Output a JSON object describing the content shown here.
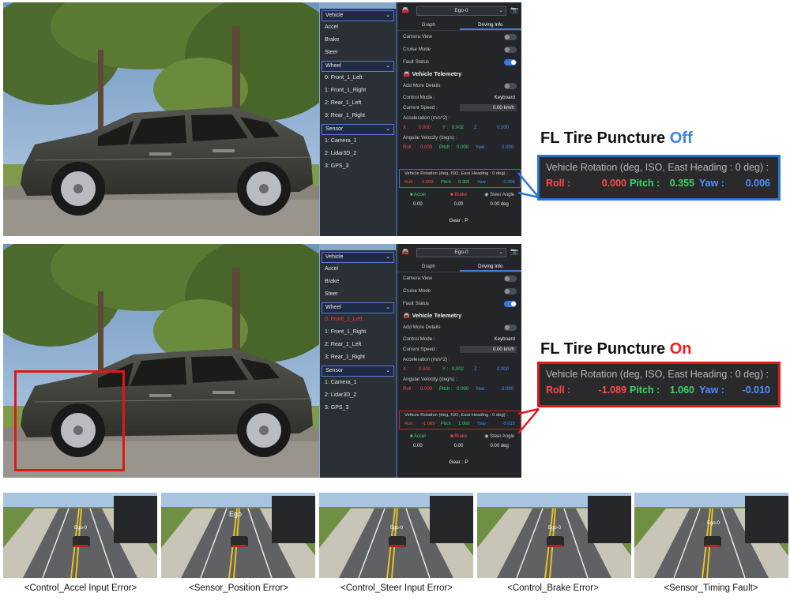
{
  "colors": {
    "accent_blue": "#2a74d0",
    "accent_red": "#e01818",
    "roll": "#ff4b4b",
    "pitch": "#3fd46a",
    "yaw": "#4f8fff"
  },
  "menu": {
    "vehicle_header": "Vehicle",
    "vehicle_items": [
      "Accel",
      "Brake",
      "Steer"
    ],
    "wheel_header": "Wheel",
    "wheel_items": [
      "0: Front_1_Left",
      "1: Front_1_Right",
      "2: Rear_1_Left",
      "3: Rear_1_Right"
    ],
    "sensor_header": "Sensor",
    "sensor_items": [
      "1: Camera_1",
      "2: Lidar3D_2",
      "3: GPS_3"
    ]
  },
  "panel": {
    "ego_select": "Ego-0",
    "tab_graph": "Graph",
    "tab_driving": "Driving Info",
    "camera_view": "Camera View",
    "cruise_mode": "Cruise Mode",
    "fault_status": "Fault Status",
    "telemetry_title": "Vehicle Telemetry",
    "add_details": "Add More Details",
    "control_mode_label": "Control Mode :",
    "control_mode_value": "Keyboard",
    "current_speed_label": "Current Speed :",
    "current_speed_value": "0.00 km/h",
    "acceleration_label": "Acceleration (m/s^2) :",
    "x_label": "X :",
    "y_label": "Y :",
    "z_label": "Z :",
    "accel_x": "0.000",
    "accel_y": "0.002",
    "accel_z": "0.000",
    "angular_label": "Angular Velocity (deg/s) :",
    "roll_label": "Roll :",
    "pitch_label": "Pitch :",
    "yaw_label": "Yaw :",
    "ang_roll": "0.000",
    "ang_pitch": "0.000",
    "ang_yaw": "0.000",
    "rotation_label": "Vehicle Rotation (deg, ISO, East Heading : 0 deg) :",
    "pedal_accel": "Accel",
    "pedal_brake": "Brake",
    "pedal_steer": "Steer Angle",
    "accel_value": "0.00",
    "brake_value": "0.00",
    "steer_value": "0.00",
    "steer_unit": "deg",
    "gear": "Gear : P"
  },
  "states": [
    {
      "title_prefix": "FL Tire Puncture",
      "title_status": "Off",
      "roll": "0.000",
      "pitch": "0.355",
      "yaw": "0.006"
    },
    {
      "title_prefix": "FL Tire Puncture",
      "title_status": "On",
      "roll": "-1.089",
      "pitch": "1.060",
      "yaw": "-0.010"
    }
  ],
  "thumbnails": [
    {
      "caption": "<Control_Accel Input Error>",
      "label": "Ego-0"
    },
    {
      "caption": "<Sensor_Position Error>",
      "label": "Ego"
    },
    {
      "caption": "<Control_Steer Input Error>",
      "label": "Ego-0"
    },
    {
      "caption": "<Control_Brake Error>",
      "label": "Ego-0"
    },
    {
      "caption": "<Sensor_Timing Fault>",
      "label": "Ego-0"
    }
  ]
}
